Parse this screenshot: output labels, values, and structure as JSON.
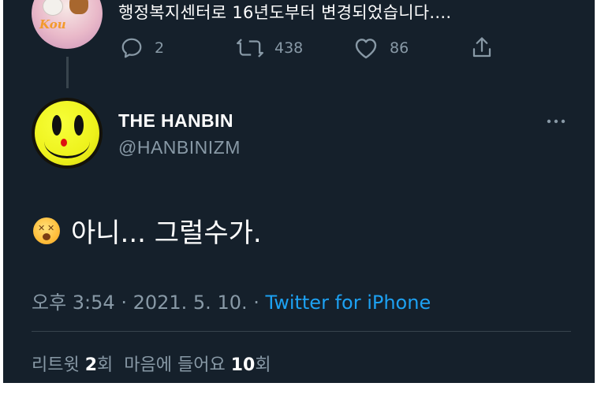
{
  "parent_tweet": {
    "text": "행정복지센터로 16년도부터 변경되었습니다....",
    "avatar_logo": "Kou",
    "reply_count": "2",
    "retweet_count": "438",
    "like_count": "86"
  },
  "tweet": {
    "display_name": "THE HANBIN",
    "handle": "@HANBINIZM",
    "body_text": "아니... 그럴수가.",
    "emoji": "dizzy-face",
    "time": "오후 3:54",
    "sep1": " · ",
    "date": "2021. 5. 10.",
    "sep2": " · ",
    "source": "Twitter for iPhone",
    "stats": {
      "retweets_label": "리트윗",
      "retweets_count": "2",
      "retweets_unit": "회",
      "likes_label": "마음에 들어요",
      "likes_count": "10",
      "likes_unit": "회"
    }
  },
  "colors": {
    "background": "#15202b",
    "text_primary": "#ffffff",
    "text_secondary": "#8899a6",
    "link": "#1da1f2",
    "divider": "#38444d"
  },
  "icons": [
    "reply-icon",
    "retweet-icon",
    "like-icon",
    "share-icon",
    "more-options-icon"
  ]
}
